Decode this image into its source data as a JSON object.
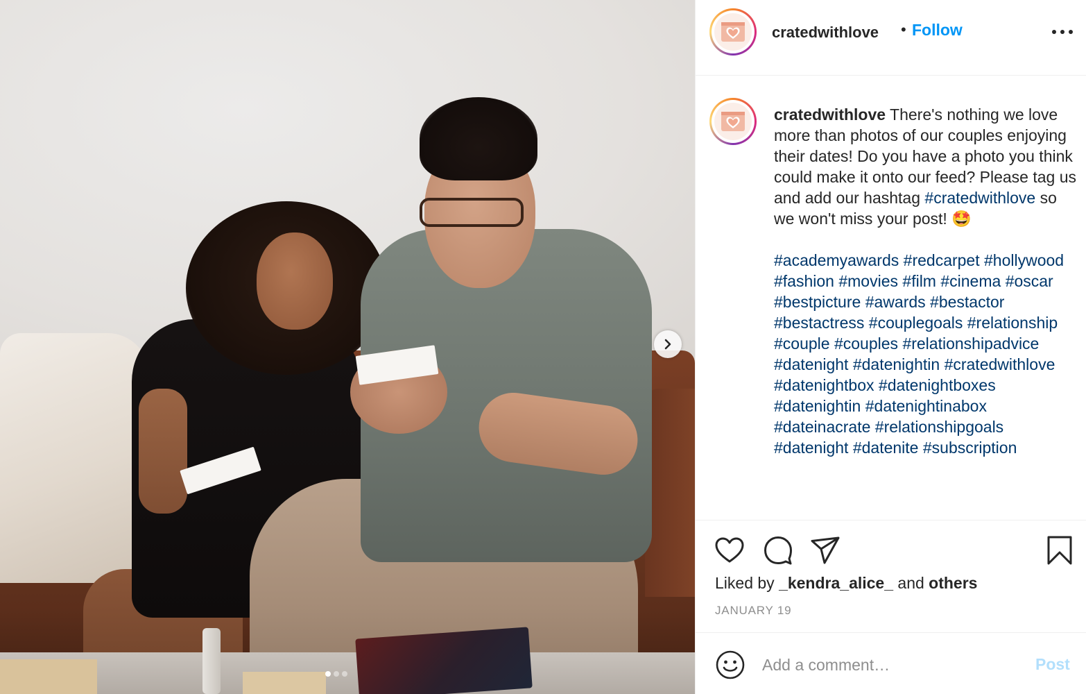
{
  "post": {
    "username": "cratedwithlove",
    "follow_label": "Follow",
    "separator": "•",
    "caption_intro": "There's nothing we love more than photos of our couples enjoying their dates! Do you have a photo you think could make it onto our feed? Please tag us and add our hashtag ",
    "caption_tag": "#cratedwithlove",
    "caption_outro": " so we won't miss your post! 🤩",
    "hashtags": [
      "#academyawards",
      "#redcarpet",
      "#hollywood",
      "#fashion",
      "#movies",
      "#film",
      "#cinema",
      "#oscar",
      "#bestpicture",
      "#awards",
      "#bestactor",
      "#bestactress",
      "#couplegoals",
      "#relationship",
      "#couple",
      "#couples",
      "#relationshipadvice",
      "#datenight",
      "#datenightin",
      "#cratedwithlove",
      "#datenightbox",
      "#datenightboxes",
      "#datenightin",
      "#datenightinabox",
      "#dateinacrate",
      "#relationshipgoals",
      "#datenight",
      "#datenite",
      "#subscription"
    ],
    "likes_prefix": "Liked by",
    "liked_by_user": "_kendra_alice_",
    "likes_and": "and",
    "likes_others": "others",
    "date": "JANUARY 19"
  },
  "carousel": {
    "dot_count": 3,
    "active_index": 0
  },
  "comment": {
    "placeholder": "Add a comment…",
    "post_label": "Post"
  },
  "colors": {
    "link": "#0095f6",
    "hashtag": "#00376b",
    "muted": "#8e8e8e",
    "post_disabled": "#b2dffc"
  },
  "icons": [
    "more-options-icon",
    "chevron-right-icon",
    "heart-icon",
    "comment-icon",
    "share-icon",
    "bookmark-icon",
    "emoji-icon"
  ]
}
